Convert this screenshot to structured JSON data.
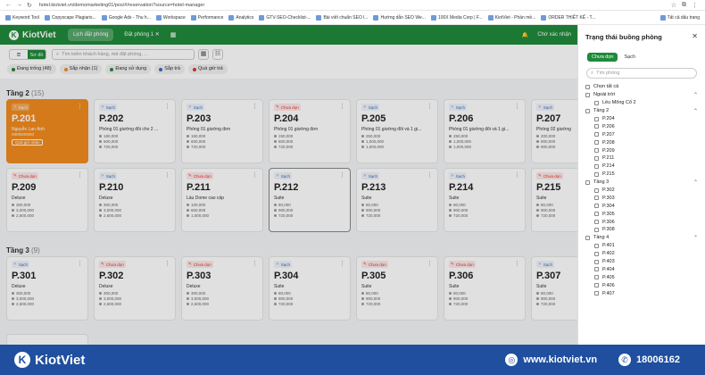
{
  "browser": {
    "url": "hotel.kiotviet.vn/demomarketing01/pos/#/reservation?source=hotel-manager",
    "bookmarks": [
      "Keyword Tool",
      "Copyscape Plagiaris...",
      "Google Ads - Thu h...",
      "Workspace",
      "Performance",
      "Analytics",
      "GTV-SEO-Checklist-...",
      "Bài viết chuẩn SEO l...",
      "Hướng dẫn SEO We...",
      "100X Media Corp | F...",
      "KiotViet - Phần mề...",
      "ORDER THIẾT KẾ - T..."
    ],
    "all_bookmarks": "Tất cả dấu trang"
  },
  "app": {
    "brand": "KiotViet",
    "tabs": [
      "Lịch đặt phòng",
      "Đặt phòng 1"
    ],
    "right_label": "Chờ xác nhận"
  },
  "toolbar": {
    "view_options": [
      "",
      "Sơ đồ"
    ],
    "search_placeholder": "Tìm kiếm khách hàng, mã đặt phòng, ..."
  },
  "filters": [
    {
      "label": "Đang trống (48)",
      "color": "#2e7d32"
    },
    {
      "label": "Sắp nhận (1)",
      "color": "#f28b1f"
    },
    {
      "label": "Đang sử dụng",
      "color": "#1f8a3b"
    },
    {
      "label": "Sắp trả",
      "color": "#3b6db3"
    },
    {
      "label": "Quá giờ trả",
      "color": "#d33"
    }
  ],
  "floors": [
    {
      "name": "Tầng 2",
      "count": "(15)",
      "rooms": [
        {
          "no": "P.201",
          "status": "Sạch",
          "state": "occupied",
          "guest": "Nguyễn Lan Anh",
          "phone": "0909000000",
          "action": "Quá giờ nhận"
        },
        {
          "no": "P.202",
          "status": "Sạch",
          "type": "Phòng 01 giường đôi cho 2 ...",
          "prices": [
            "180,000",
            "600,000",
            "720,000"
          ]
        },
        {
          "no": "P.203",
          "status": "Sạch",
          "type": "Phòng 01 giường đơn",
          "prices": [
            "150,000",
            "600,000",
            "720,000"
          ]
        },
        {
          "no": "P.204",
          "status": "Chưa dọn",
          "type": "Phòng 01 giường đơn",
          "prices": [
            "150,000",
            "600,000",
            "720,000"
          ]
        },
        {
          "no": "P.205",
          "status": "Sạch",
          "type": "Phòng 01 giường đôi và 1 gi...",
          "prices": [
            "250,000",
            "1,000,000",
            "1,000,000"
          ]
        },
        {
          "no": "P.206",
          "status": "Sạch",
          "type": "Phòng 01 giường đôi và 1 gi...",
          "prices": [
            "250,000",
            "1,000,000",
            "1,000,000"
          ]
        },
        {
          "no": "P.207",
          "status": "Sạch",
          "type": "Phòng 02 giường",
          "prices": [
            "200,000",
            "800,000",
            "900,000"
          ]
        }
      ]
    },
    {
      "rooms": [
        {
          "no": "P.209",
          "status": "Chưa dọn",
          "type": "Deluxe",
          "prices": [
            "300,000",
            "3,000,000",
            "2,600,000"
          ]
        },
        {
          "no": "P.210",
          "status": "Sạch",
          "type": "Deluxe",
          "prices": [
            "300,000",
            "3,000,000",
            "2,600,000"
          ]
        },
        {
          "no": "P.211",
          "status": "Chưa dọn",
          "type": "Lầu Dome cao cấp",
          "prices": [
            "100,000",
            "600,000",
            "1,000,000"
          ]
        },
        {
          "no": "P.212",
          "status": "Sạch",
          "type": "Suite",
          "prices": [
            "80,000",
            "900,000",
            "720,000"
          ]
        },
        {
          "no": "P.213",
          "status": "Sạch",
          "type": "Suite",
          "prices": [
            "80,000",
            "900,000",
            "720,000"
          ]
        },
        {
          "no": "P.214",
          "status": "Sạch",
          "type": "Suite",
          "prices": [
            "80,000",
            "900,000",
            "720,000"
          ]
        },
        {
          "no": "P.215",
          "status": "Chưa dọn",
          "type": "Suite",
          "prices": [
            "80,000",
            "900,000",
            "720,000"
          ]
        }
      ]
    },
    {
      "name": "Tầng 3",
      "count": "(9)",
      "rooms": [
        {
          "no": "P.301",
          "status": "Sạch",
          "type": "Deluxe",
          "prices": [
            "300,000",
            "3,000,000",
            "2,600,000"
          ]
        },
        {
          "no": "P.302",
          "status": "Chưa dọn",
          "type": "Deluxe",
          "prices": [
            "300,000",
            "3,000,000",
            "2,600,000"
          ]
        },
        {
          "no": "P.303",
          "status": "Chưa dọn",
          "type": "Deluxe",
          "prices": [
            "300,000",
            "3,000,000",
            "2,600,000"
          ]
        },
        {
          "no": "P.304",
          "status": "Sạch",
          "type": "Suite",
          "prices": [
            "80,000",
            "900,000",
            "720,000"
          ]
        },
        {
          "no": "P.305",
          "status": "Chưa dọn",
          "type": "Suite",
          "prices": [
            "80,000",
            "900,000",
            "720,000"
          ]
        },
        {
          "no": "P.306",
          "status": "Chưa dọn",
          "type": "Suite",
          "prices": [
            "80,000",
            "900,000",
            "720,000"
          ]
        },
        {
          "no": "P.307",
          "status": "Sạch",
          "type": "Suite",
          "prices": [
            "80,000",
            "900,000",
            "720,000"
          ]
        }
      ]
    }
  ],
  "panel": {
    "title": "Trạng thái buồng phòng",
    "tabs": [
      "Chưa dọn",
      "Sạch"
    ],
    "search_placeholder": "Tìm phòng",
    "items": [
      {
        "label": "Chọn tất cả",
        "level": 0
      },
      {
        "label": "Ngoài trời",
        "level": 0,
        "group": true
      },
      {
        "label": "Lều Mông Cổ 2",
        "level": 1
      },
      {
        "label": "Tầng 2",
        "level": 0,
        "group": true
      },
      {
        "label": "P.204",
        "level": 1
      },
      {
        "label": "P.206",
        "level": 1
      },
      {
        "label": "P.207",
        "level": 1
      },
      {
        "label": "P.208",
        "level": 1
      },
      {
        "label": "P.209",
        "level": 1
      },
      {
        "label": "P.211",
        "level": 1
      },
      {
        "label": "P.214",
        "level": 1
      },
      {
        "label": "P.215",
        "level": 1
      },
      {
        "label": "Tầng 3",
        "level": 0,
        "group": true
      },
      {
        "label": "P.302",
        "level": 1
      },
      {
        "label": "P.303",
        "level": 1
      },
      {
        "label": "P.304",
        "level": 1
      },
      {
        "label": "P.305",
        "level": 1
      },
      {
        "label": "P.306",
        "level": 1
      },
      {
        "label": "P.308",
        "level": 1
      },
      {
        "label": "Tầng 4",
        "level": 0,
        "group": true
      },
      {
        "label": "P.401",
        "level": 1
      },
      {
        "label": "P.402",
        "level": 1
      },
      {
        "label": "P.403",
        "level": 1
      },
      {
        "label": "P.404",
        "level": 1
      },
      {
        "label": "P.405",
        "level": 1
      },
      {
        "label": "P.406",
        "level": 1
      },
      {
        "label": "P.407",
        "level": 1
      }
    ]
  },
  "banner": {
    "brand": "KiotViet",
    "website": "www.kiotviet.vn",
    "hotline": "18006162"
  }
}
